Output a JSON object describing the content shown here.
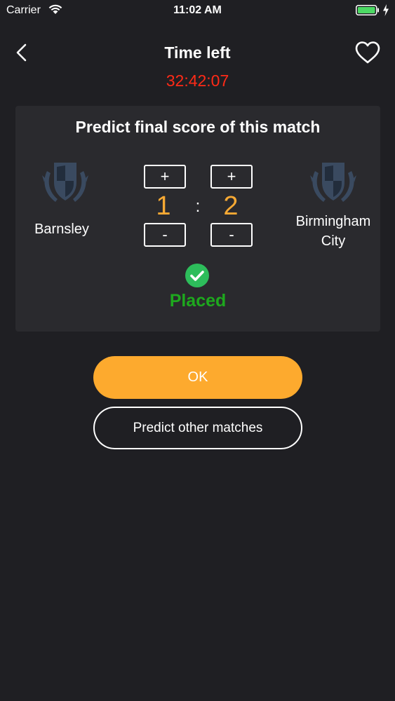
{
  "status_bar": {
    "carrier": "Carrier",
    "time": "11:02 AM"
  },
  "header": {
    "title": "Time left",
    "countdown": "32:42:07",
    "countdown_color": "#ff2a17"
  },
  "prediction": {
    "title": "Predict final score of this match",
    "home_team": "Barnsley",
    "away_team_line1": "Birmingham",
    "away_team_line2": "City",
    "home_score": "1",
    "away_score": "2",
    "separator": ":",
    "plus_label": "+",
    "minus_label": "-",
    "status": "Placed",
    "status_color": "#1ea81e",
    "score_color": "#f7a934"
  },
  "actions": {
    "ok_label": "OK",
    "ok_color": "#fdaa2e",
    "other_label": "Predict other matches"
  },
  "icons": {
    "back": "chevron-left-icon",
    "favorite": "heart-icon",
    "crest": "shield-crest-icon",
    "check": "check-circle-icon"
  }
}
